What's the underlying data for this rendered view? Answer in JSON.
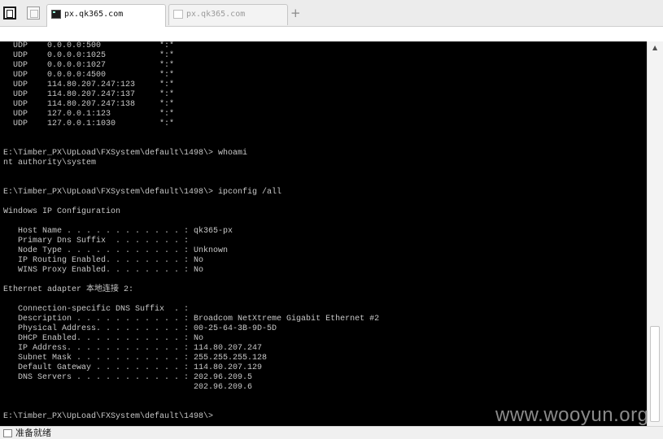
{
  "tabs": [
    {
      "label": "px.qk365.com",
      "icon": "terminal-icon",
      "active": true
    },
    {
      "label": "px.qk365.com",
      "icon": "document-icon",
      "active": false
    }
  ],
  "new_tab_label": "+",
  "scrollbar": {
    "up_arrow": "▲"
  },
  "terminal": {
    "lines": [
      "  UDP    0.0.0.0:500            *:*",
      "  UDP    0.0.0.0:1025           *:*",
      "  UDP    0.0.0.0:1027           *:*",
      "  UDP    0.0.0.0:4500           *:*",
      "  UDP    114.80.207.247:123     *:*",
      "  UDP    114.80.207.247:137     *:*",
      "  UDP    114.80.207.247:138     *:*",
      "  UDP    127.0.0.1:123          *:*",
      "  UDP    127.0.0.1:1030         *:*",
      "",
      "",
      "E:\\Timber_PX\\UpLoad\\FXSystem\\default\\1498\\> whoami",
      "nt authority\\system",
      "",
      "",
      "E:\\Timber_PX\\UpLoad\\FXSystem\\default\\1498\\> ipconfig /all",
      "",
      "Windows IP Configuration",
      "",
      "   Host Name . . . . . . . . . . . . : qk365-px",
      "   Primary Dns Suffix  . . . . . . . :",
      "   Node Type . . . . . . . . . . . . : Unknown",
      "   IP Routing Enabled. . . . . . . . : No",
      "   WINS Proxy Enabled. . . . . . . . : No",
      "",
      "Ethernet adapter 本地连接 2:",
      "",
      "   Connection-specific DNS Suffix  . :",
      "   Description . . . . . . . . . . . : Broadcom NetXtreme Gigabit Ethernet #2",
      "   Physical Address. . . . . . . . . : 00-25-64-3B-9D-5D",
      "   DHCP Enabled. . . . . . . . . . . : No",
      "   IP Address. . . . . . . . . . . . : 114.80.207.247",
      "   Subnet Mask . . . . . . . . . . . : 255.255.255.128",
      "   Default Gateway . . . . . . . . . : 114.80.207.129",
      "   DNS Servers . . . . . . . . . . . : 202.96.209.5",
      "                                       202.96.209.6",
      "",
      "",
      "E:\\Timber_PX\\UpLoad\\FXSystem\\default\\1498\\>"
    ]
  },
  "watermark": "www.wooyun.org",
  "status": {
    "text": "准备就绪",
    "icon": "status-page-icon"
  },
  "colors": {
    "terminal_bg": "#000000",
    "terminal_fg": "#c8c8c8"
  }
}
